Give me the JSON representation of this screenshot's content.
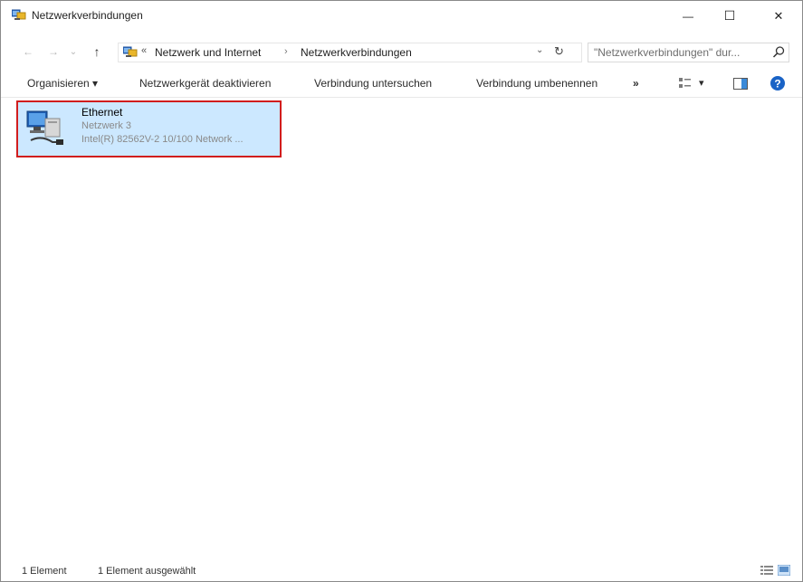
{
  "window": {
    "title": "Netzwerkverbindungen",
    "icon": "network-connections-icon"
  },
  "titlebar": {
    "minimize": "—",
    "maximize": "☐",
    "close": "✕"
  },
  "nav": {
    "back": "←",
    "forward": "→",
    "recent": "⌄",
    "up": "↑"
  },
  "address": {
    "overflow": "«",
    "crumbs": [
      "Netzwerk und Internet",
      "Netzwerkverbindungen"
    ],
    "separator": "›",
    "dropdown": "⌄",
    "refresh": "↻"
  },
  "search": {
    "placeholder": "\"Netzwerkverbindungen\" dur..."
  },
  "toolbar": {
    "organize": "Organisieren ▾",
    "disable": "Netzwerkgerät deaktivieren",
    "diagnose": "Verbindung untersuchen",
    "rename": "Verbindung umbenennen",
    "more": "»",
    "view_dropdown": "▾"
  },
  "items": [
    {
      "name": "Ethernet",
      "network": "Netzwerk 3",
      "adapter": "Intel(R) 82562V-2 10/100 Network ..."
    }
  ],
  "status": {
    "count": "1 Element",
    "selected": "1 Element ausgewählt"
  },
  "colors": {
    "selection_bg": "#cce8ff",
    "highlight_border": "#d11d1d",
    "help_blue": "#1a63c6"
  }
}
